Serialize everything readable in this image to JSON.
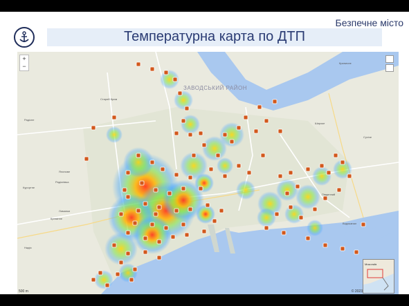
{
  "header": {
    "brand": "Безпечне місто",
    "title": "Температурна карта по ДТП"
  },
  "map": {
    "zoom_in": "+",
    "zoom_out": "−",
    "district_label": "ЗАВОДСЬКИЙ РАЙОН",
    "place_labels": [
      "Старий Крим",
      "Криничне",
      "Радісне",
      "Ялинове",
      "Радіонівка",
      "Курортне",
      "Лиманки",
      "Кремінне",
      "Надія",
      "Широке",
      "Сухіче",
      "Водоканал",
      "Південний"
    ],
    "scale_text": "500 m",
    "attribution": "© 2023",
    "inset_caption": "Миколаїв",
    "colors": {
      "heat_low": "#4aa8ff",
      "heat_mid": "#7ee34f",
      "heat_high": "#ffd500",
      "heat_peak": "#ff3b1f",
      "marker": "#d2581c",
      "sea": "#a9c8ef",
      "land": "#eaeadf"
    }
  }
}
